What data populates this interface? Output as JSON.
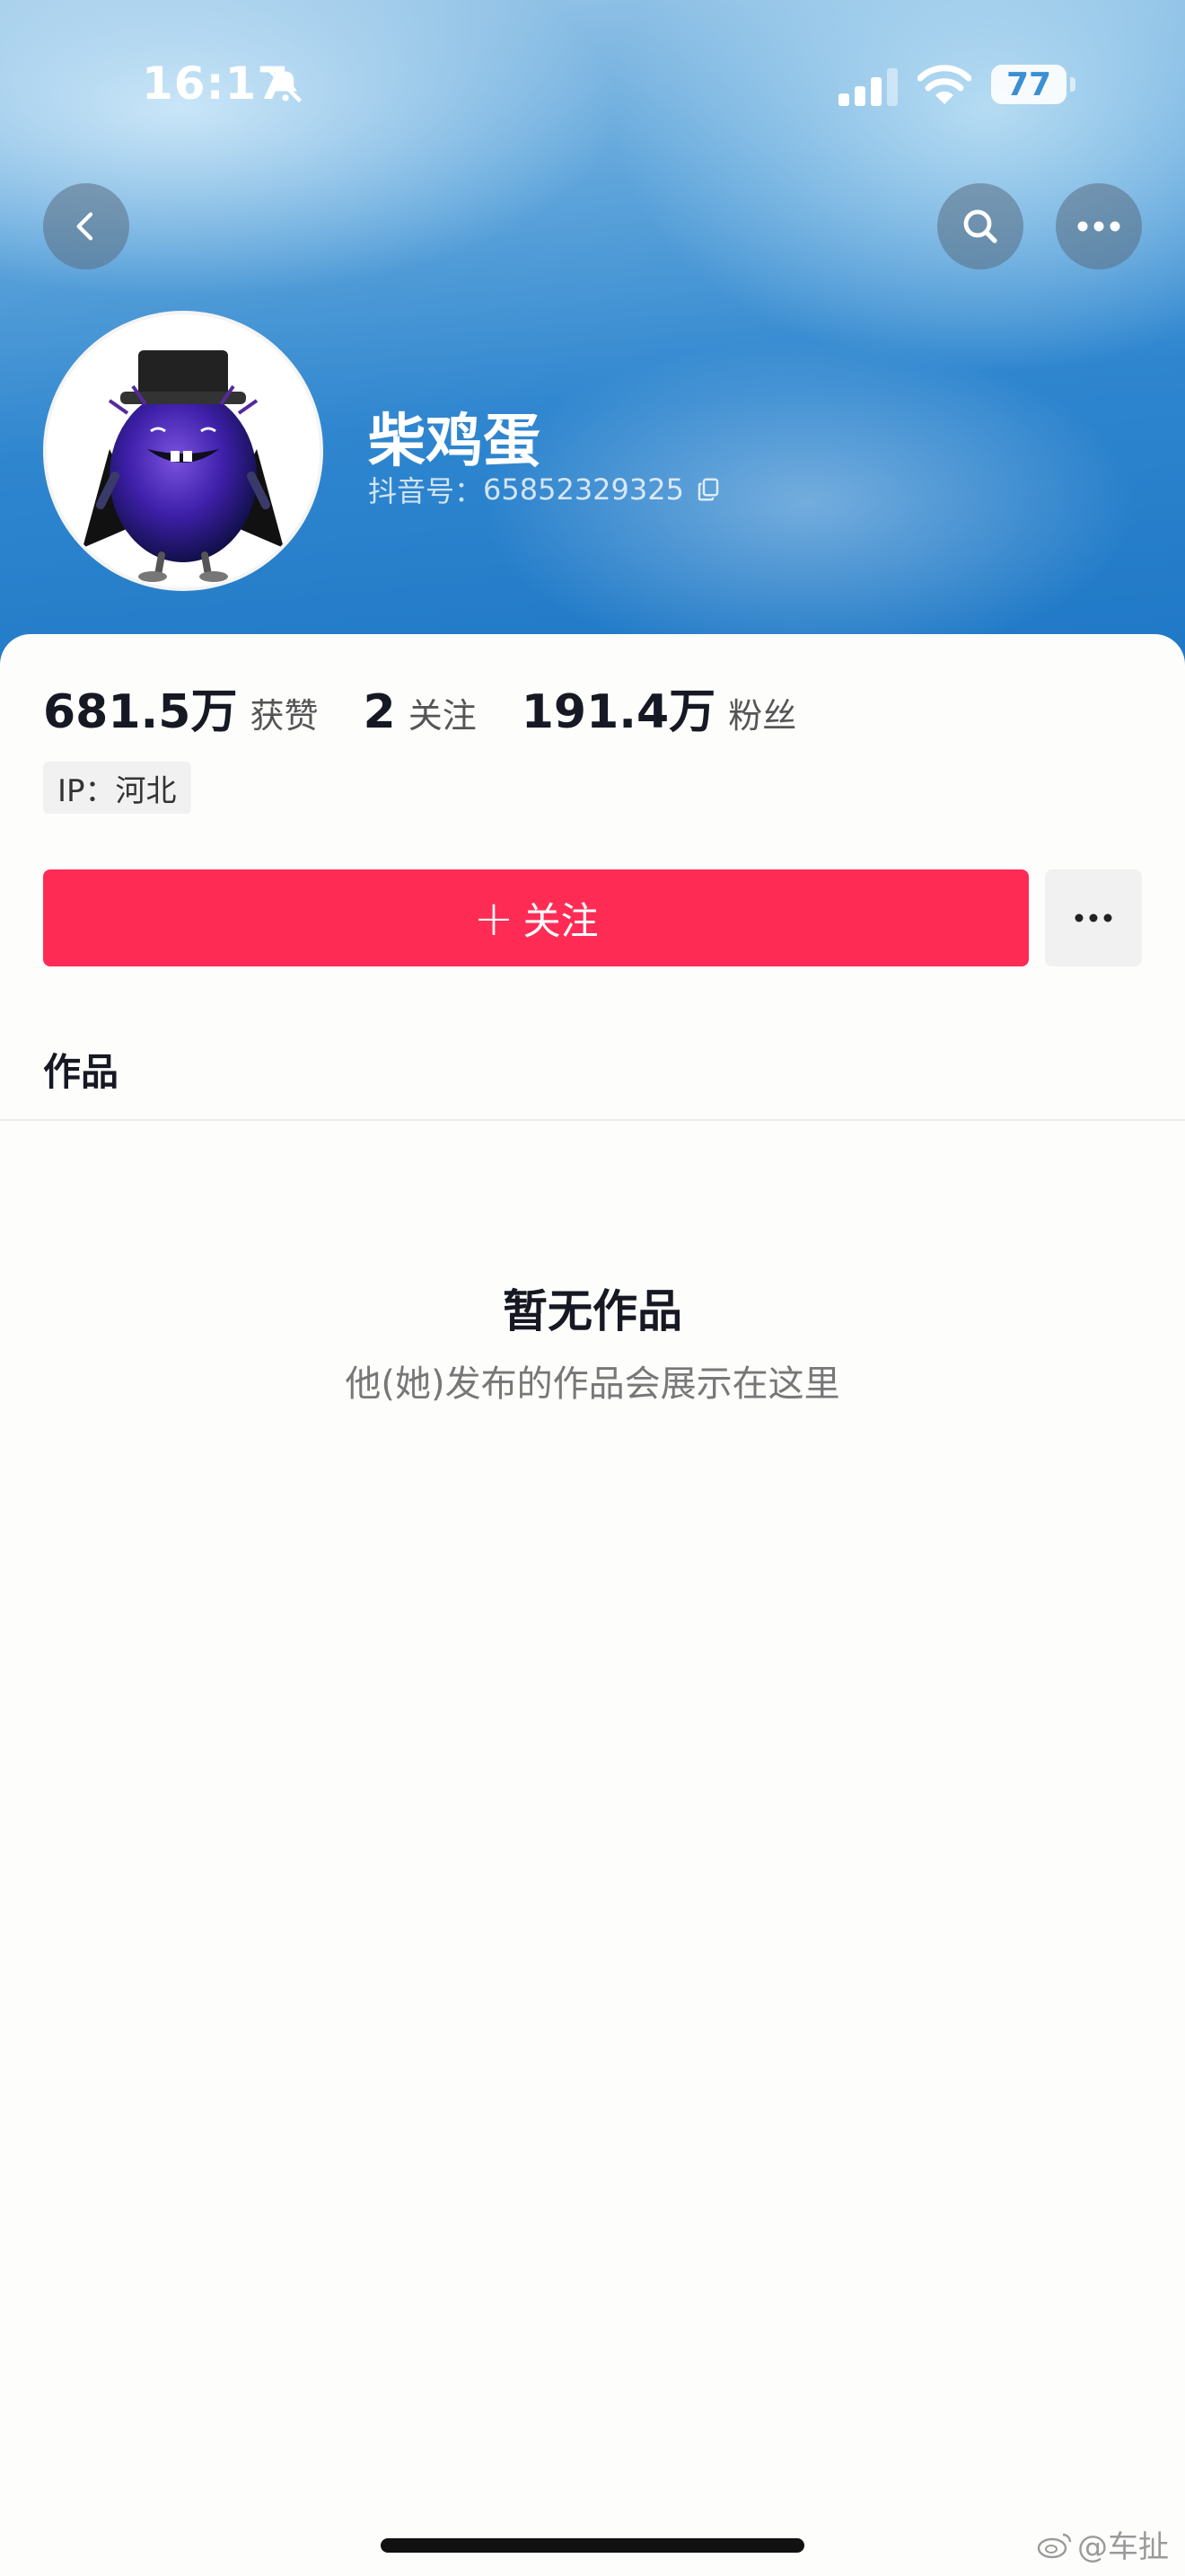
{
  "status_bar": {
    "time": "16:17",
    "battery": "77",
    "icons": [
      "bell-slash-icon",
      "signal-icon",
      "wifi-icon"
    ]
  },
  "nav": {
    "icons": [
      "chevron-left-icon",
      "search-icon",
      "more-horizontal-icon"
    ]
  },
  "profile": {
    "name": "柴鸡蛋",
    "id_label": "抖音号：",
    "id_value": "65852329325"
  },
  "stats": {
    "likes_num": "681.5万",
    "likes_label": "获赞",
    "following_num": "2",
    "following_label": "关注",
    "followers_num": "191.4万",
    "followers_label": "粉丝"
  },
  "ip_tag": "IP：河北",
  "actions": {
    "follow_label": "关注",
    "follow_plus": "+"
  },
  "tabs": {
    "works": "作品"
  },
  "empty_state": {
    "title": "暂无作品",
    "subtitle": "他(她)发布的作品会展示在这里"
  },
  "watermark": "@车扯",
  "colors": {
    "accent": "#fe2c55",
    "header_blue": "#2f86cf",
    "text_primary": "#161823"
  }
}
